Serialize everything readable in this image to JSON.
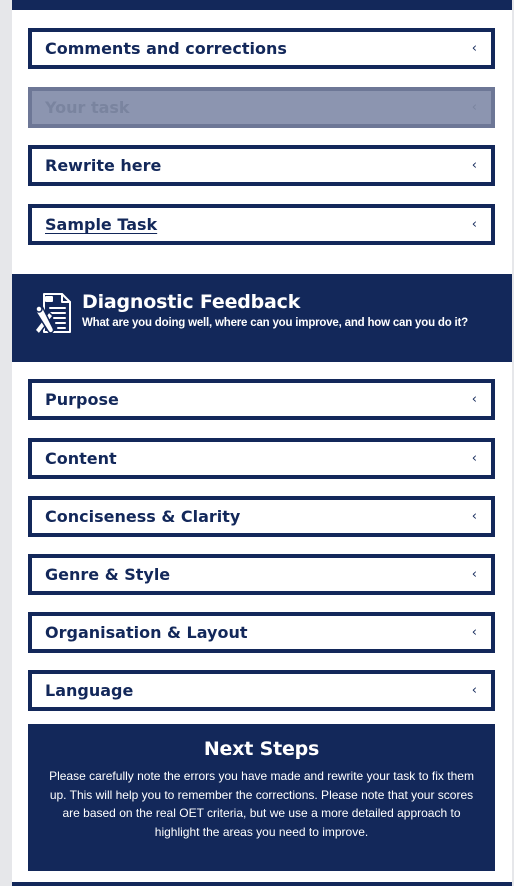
{
  "accordion_top": [
    {
      "label": "Comments and corrections",
      "chevron": "‹"
    },
    {
      "label": "Your task",
      "chevron": "‹"
    },
    {
      "label": "Rewrite here",
      "chevron": "‹"
    },
    {
      "label": "Sample Task",
      "chevron": "‹"
    }
  ],
  "feedback": {
    "title": "Diagnostic Feedback",
    "subtitle": "What are you doing well, where can you improve, and how can you do it?",
    "icon": "document-tools-icon"
  },
  "accordion_criteria": [
    {
      "label": "Purpose",
      "chevron": "‹"
    },
    {
      "label": "Content",
      "chevron": "‹"
    },
    {
      "label": "Conciseness & Clarity",
      "chevron": "‹"
    },
    {
      "label": "Genre & Style",
      "chevron": "‹"
    },
    {
      "label": "Organisation & Layout",
      "chevron": "‹"
    },
    {
      "label": "Language",
      "chevron": "‹"
    }
  ],
  "next_steps": {
    "title": "Next Steps",
    "body": "Please carefully note the errors you have made and rewrite your task to fix them up. This will help you to remember the corrections. Please note that your scores are based on the real OET criteria, but we use a more detailed approach to highlight the areas you need to improve."
  },
  "colors": {
    "brand_navy": "#13285a",
    "disabled_fill": "#8c95b0",
    "background": "#ffffff"
  }
}
